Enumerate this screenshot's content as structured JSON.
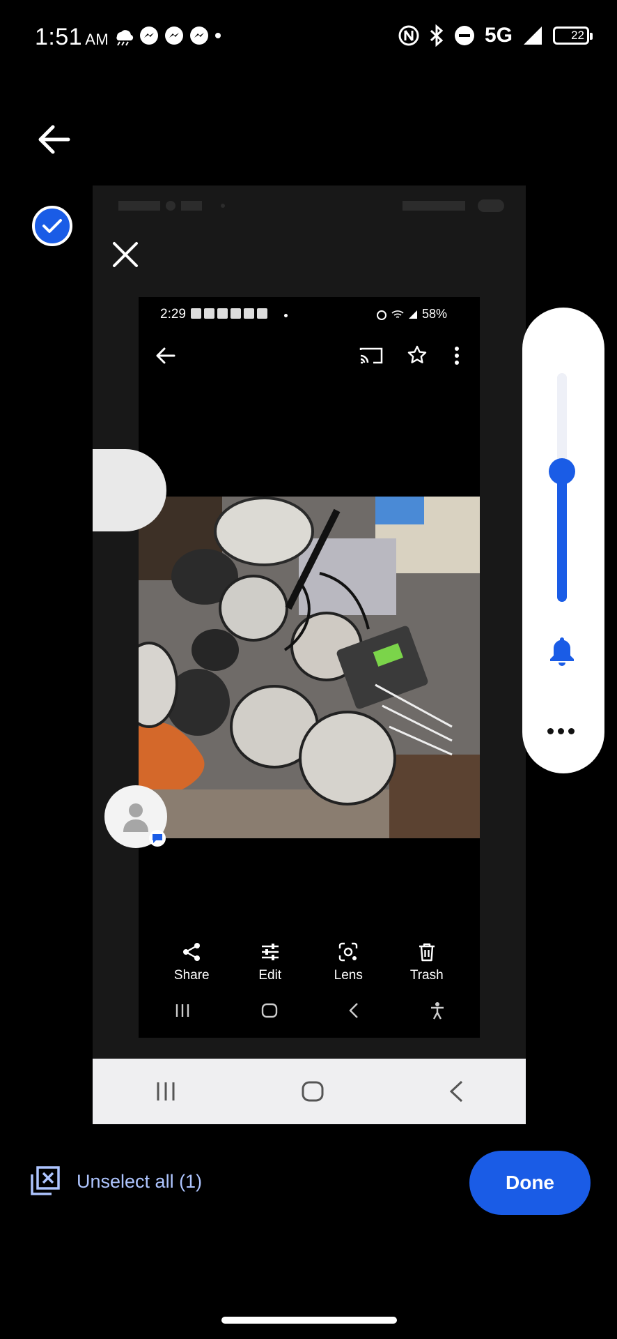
{
  "status_bar": {
    "time": "1:51",
    "ampm": "AM",
    "network": "5G",
    "battery": "22"
  },
  "card": {
    "inner_screenshot": {
      "status_time": "2:29",
      "status_battery": "58%",
      "actions": [
        {
          "label": "Share",
          "icon": "share-icon"
        },
        {
          "label": "Edit",
          "icon": "edit-icon"
        },
        {
          "label": "Lens",
          "icon": "lens-icon"
        },
        {
          "label": "Trash",
          "icon": "trash-icon"
        }
      ]
    }
  },
  "bottom": {
    "unselect_label": "Unselect all (1)",
    "done_label": "Done"
  },
  "volume": {
    "level": 0.58
  },
  "colors": {
    "accent": "#1a5ce6",
    "link": "#aec5ff"
  }
}
